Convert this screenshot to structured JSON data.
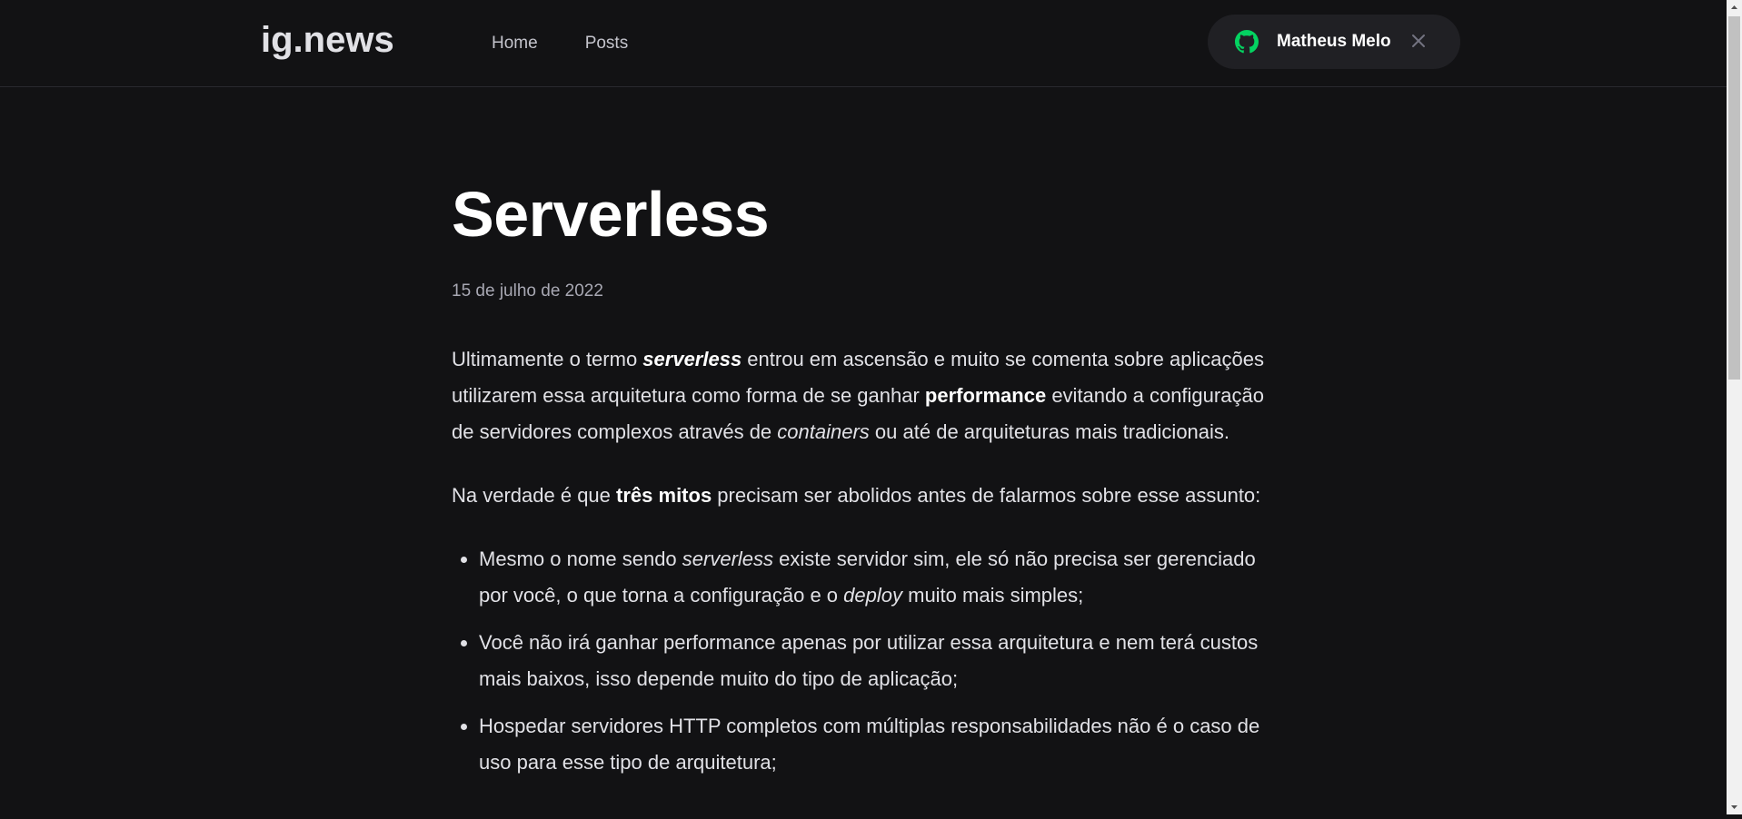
{
  "header": {
    "logo_text": "ig.news",
    "nav": [
      {
        "label": "Home"
      },
      {
        "label": "Posts"
      }
    ],
    "user_button": {
      "name": "Matheus Melo",
      "icon": "github-icon",
      "close_icon": "close-icon",
      "accent_color": "#04d361"
    }
  },
  "post": {
    "title": "Serverless",
    "date": "15 de julho de 2022",
    "p1": {
      "t1": "Ultimamente o termo ",
      "em1": "serverless",
      "t2": " entrou em ascensão e muito se comenta sobre aplicações utilizarem essa arquitetura como forma de se ganhar ",
      "strong1": "performance",
      "t3": " evitando a configuração de servidores complexos através de ",
      "em2": "containers",
      "t4": " ou até de arquiteturas mais tradicionais."
    },
    "p2": {
      "t1": "Na verdade é que ",
      "strong1": "três mitos",
      "t2": " precisam ser abolidos antes de falarmos sobre esse assunto:"
    },
    "list": {
      "item1": {
        "t1": "Mesmo o nome sendo ",
        "em1": "serverless",
        "t2": " existe servidor sim, ele só não precisa ser gerenciado por você, o que torna a configuração e o ",
        "em2": "deploy",
        "t3": " muito mais simples;"
      },
      "item2": "Você não irá ganhar performance apenas por utilizar essa arquitetura e nem terá custos mais baixos, isso depende muito do tipo de aplicação;",
      "item3": "Hospedar servidores HTTP completos com múltiplas responsabilidades não é o caso de uso para esse tipo de arquitetura;"
    }
  },
  "colors": {
    "background": "#121214",
    "header_border": "#29292e",
    "button_bg": "#202024",
    "text": "#e1e1e6",
    "muted": "#a8a8b3"
  }
}
